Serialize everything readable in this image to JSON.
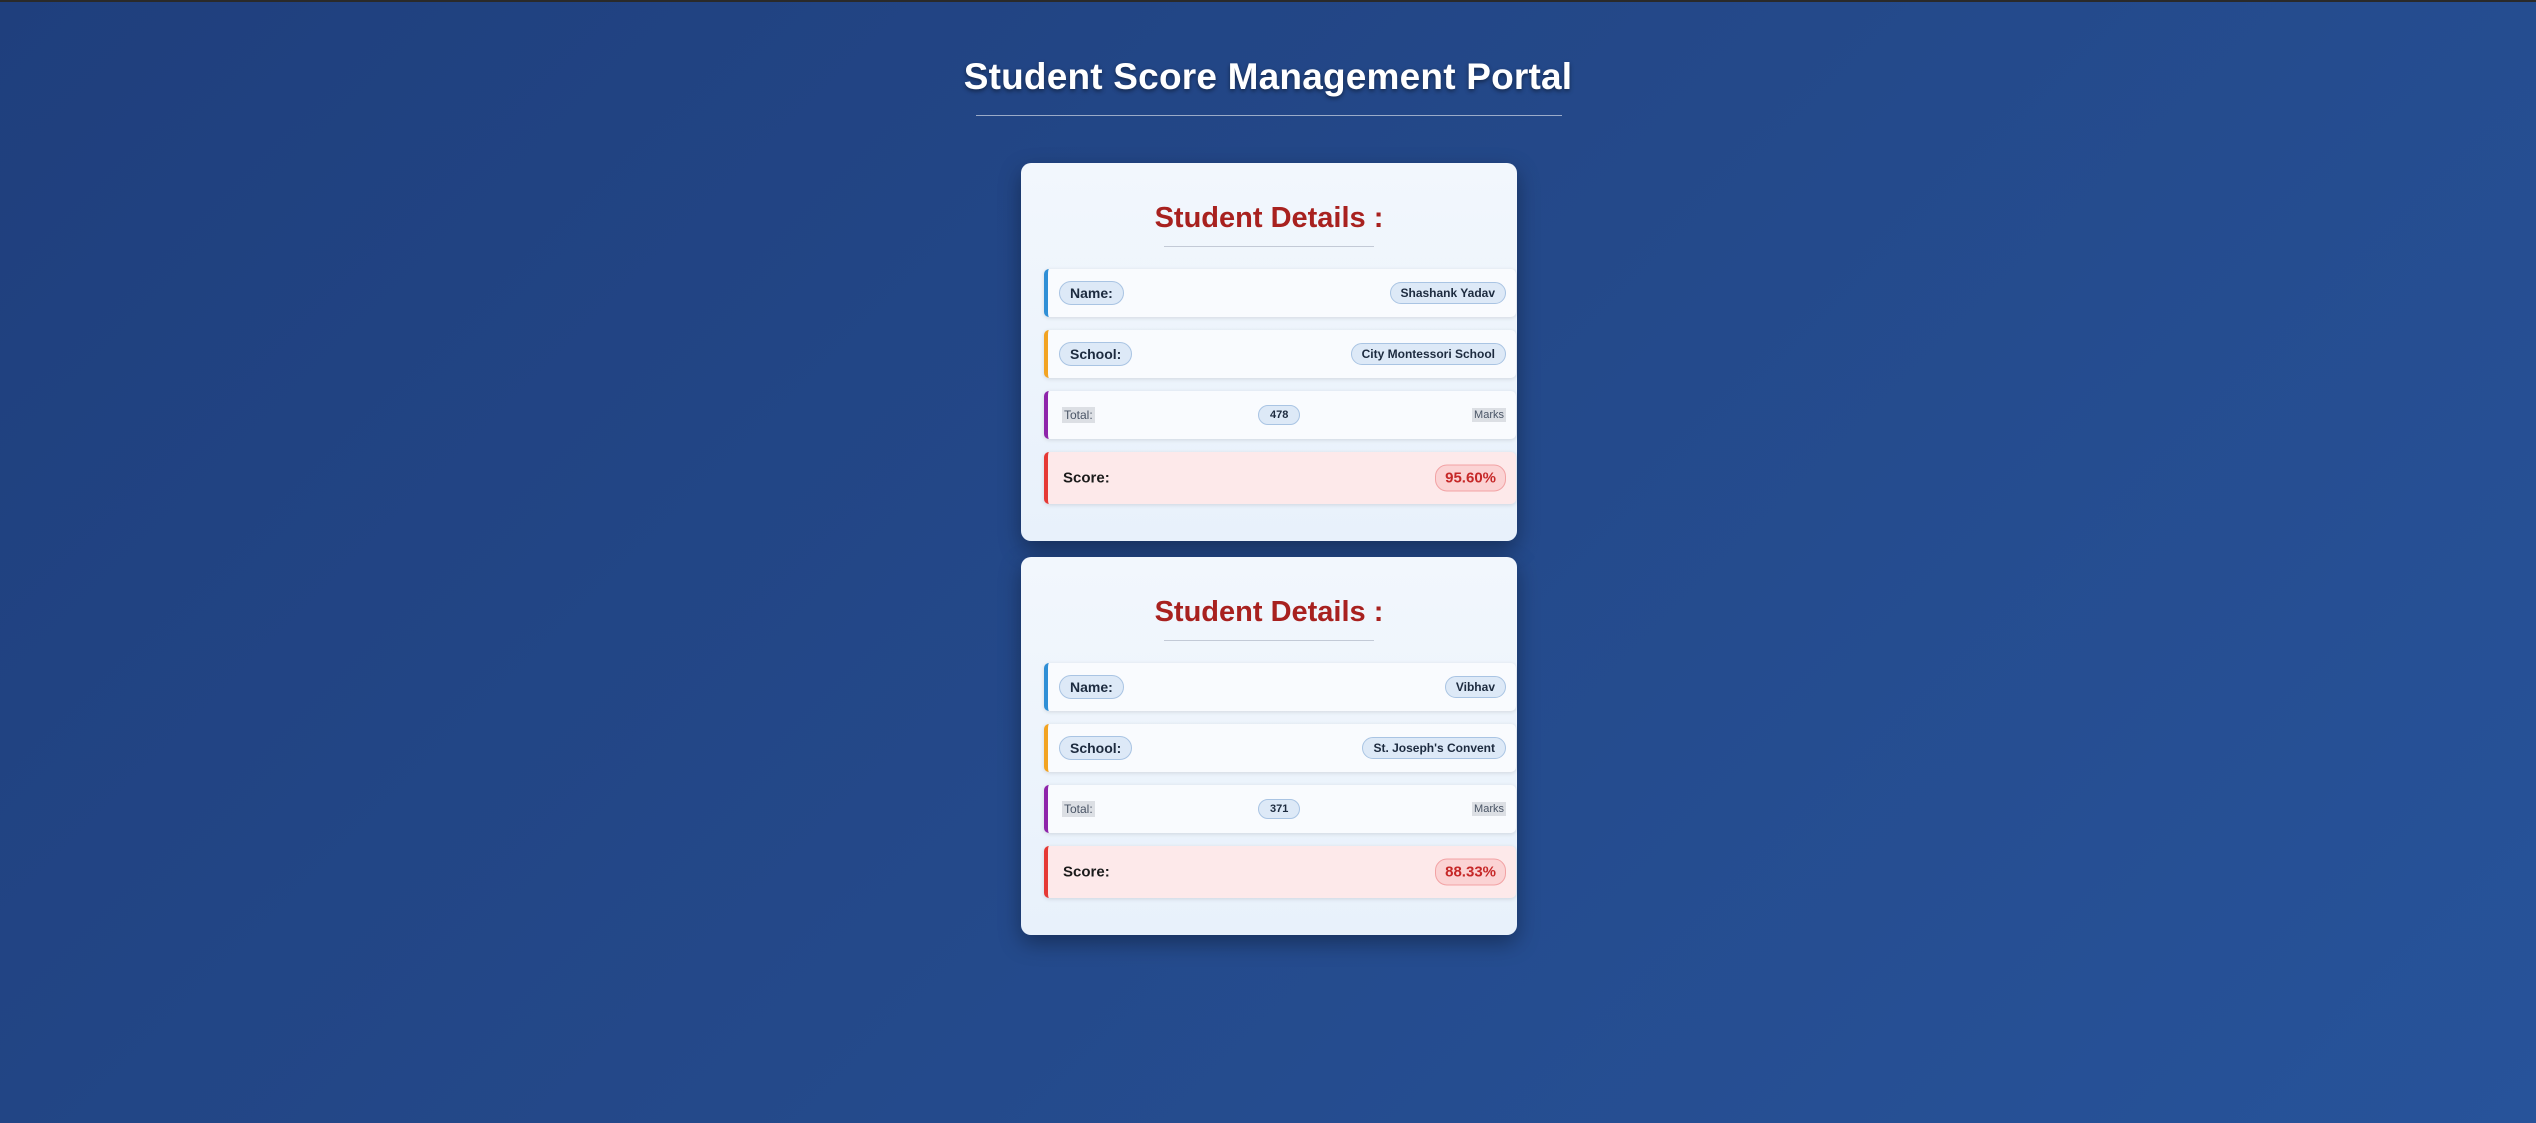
{
  "header": {
    "title": "Student Score Management Portal"
  },
  "students": [
    {
      "heading": "Student Details :",
      "name_label": "Name:",
      "name": "Shashank Yadav",
      "school_label": "School:",
      "school": "City Montessori School",
      "total_label": "Total:",
      "total": "478",
      "total_unit": "Marks",
      "score_label": "Score:",
      "score": "95.60%"
    },
    {
      "heading": "Student Details :",
      "name_label": "Name:",
      "name": "Vibhav",
      "school_label": "School:",
      "school": "St. Joseph's Convent",
      "total_label": "Total:",
      "total": "371",
      "total_unit": "Marks",
      "score_label": "Score:",
      "score": "88.33%"
    }
  ],
  "colors": {
    "background": "#24498a",
    "heading": "#a8211f",
    "name_accent": "#2f8fd6",
    "school_accent": "#f2a322",
    "total_accent": "#8e24aa",
    "score_accent": "#e53935",
    "score_text": "#c62828"
  }
}
